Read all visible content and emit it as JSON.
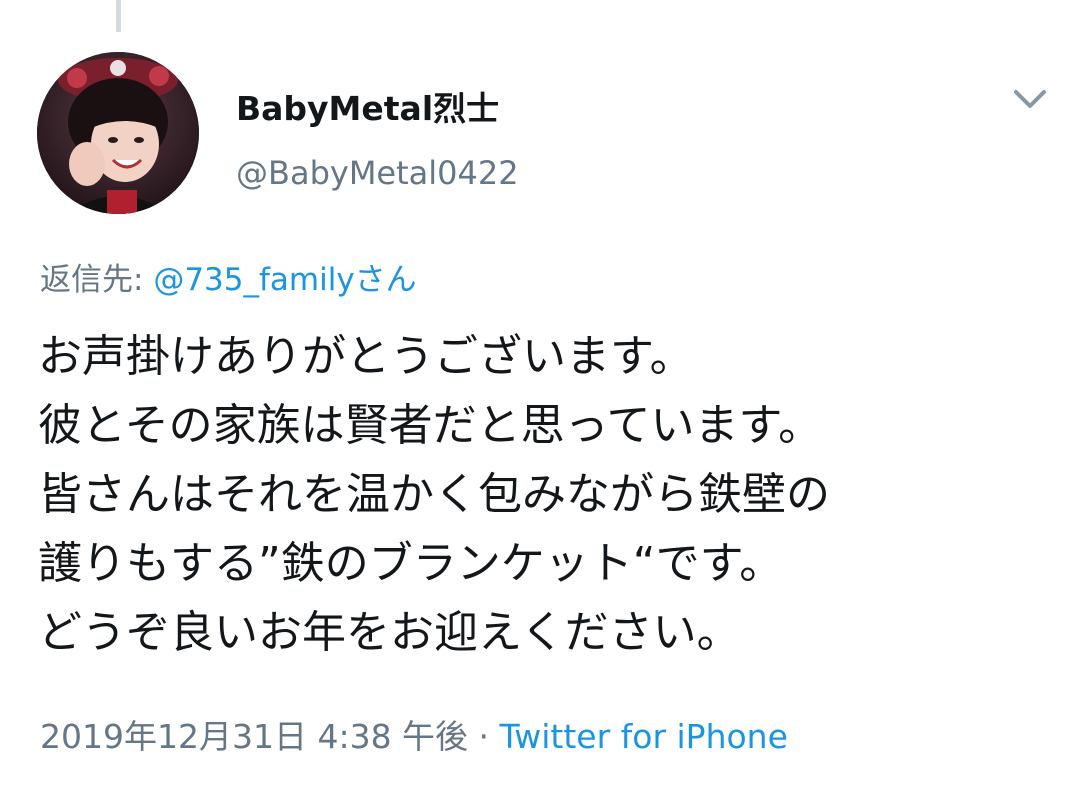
{
  "author": {
    "display_name": "BabyMetal烈士",
    "handle": "@BabyMetal0422"
  },
  "reply": {
    "prefix": "返信先: ",
    "mention": "@735_familyさん"
  },
  "tweet": {
    "lines": [
      "お声掛けありがとうございます。",
      "彼とその家族は賢者だと思っています。",
      "皆さんはそれを温かく包みながら鉄壁の",
      "護りもする”鉄のブランケット“です。",
      "どうぞ良いお年をお迎えください。"
    ]
  },
  "meta": {
    "timestamp": "2019年12月31日 4:38 午後",
    "separator": " · ",
    "source": "Twitter for iPhone"
  },
  "icons": {
    "menu": "chevron-down-icon",
    "avatar": "profile-photo"
  },
  "colors": {
    "link": "#1b95e0",
    "secondary_text": "#657786",
    "primary_text": "#14171a",
    "thread_line": "#d6dbdf"
  }
}
